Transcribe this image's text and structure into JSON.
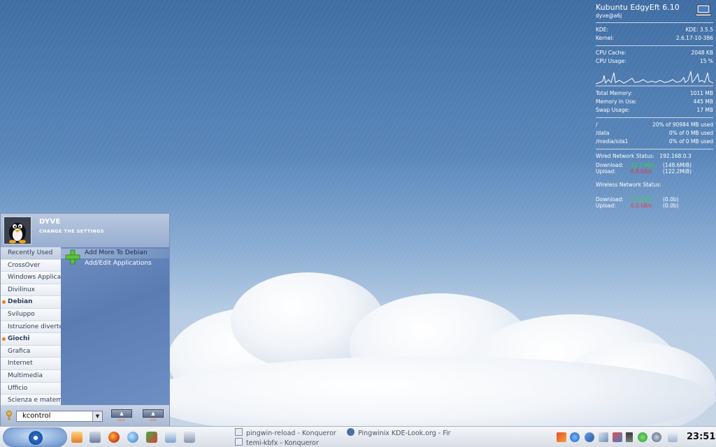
{
  "sysmon": {
    "title": "Kubuntu EdgyEft 6.10",
    "user_host": "dyve@a6j",
    "rows1": [
      {
        "label": "KDE:",
        "value": "KDE: 3.5.5"
      },
      {
        "label": "Kernel:",
        "value": "2.6.17-10-386"
      }
    ],
    "rows2": [
      {
        "label": "CPU Cache:",
        "value": "2048 KB"
      },
      {
        "label": "CPU Usage:",
        "value": "15 %"
      }
    ],
    "rows3": [
      {
        "label": "Total Memory:",
        "value": "1011 MB"
      },
      {
        "label": "Memory In Use:",
        "value": "445 MB"
      },
      {
        "label": "Swap Usage:",
        "value": "17 MB"
      }
    ],
    "disks": [
      {
        "label": "/",
        "value": "20% of 90984 MB used"
      },
      {
        "label": "/data",
        "value": "0% of 0 MB used"
      },
      {
        "label": "/media/sda1",
        "value": "0% of 0 MB used"
      }
    ],
    "wired_label": "Wired Network Status:",
    "wired_ip": "192.168.0.3",
    "download_label": "Download:",
    "upload_label": "Upload:",
    "wired_down_rate": "16.2 kB/s",
    "wired_down_total": "(148.6MiB)",
    "wired_up_rate": "6.8 kB/s",
    "wired_up_total": "(122.2MiB)",
    "wireless_label": "Wireless Network Status:",
    "wl_down_rate": "0.0 kB/s",
    "wl_down_total": "(0.0b)",
    "wl_up_rate": "0.0 kB/s",
    "wl_up_total": "(0.0b)",
    "colors": {
      "download": "#3ad43a",
      "upload": "#e23a3a"
    }
  },
  "menu": {
    "user_name": "DYVE",
    "user_sub": "CHANGE THE SETTINGS",
    "categories": [
      {
        "label": "Recently Used"
      },
      {
        "label": "CrossOver"
      },
      {
        "label": "Windows Applicat"
      },
      {
        "label": "Divilinux"
      },
      {
        "label": "Debian"
      },
      {
        "label": "Sviluppo"
      },
      {
        "label": "Istruzione diverte"
      },
      {
        "label": "Giochi"
      },
      {
        "label": "Grafica"
      },
      {
        "label": "Internet"
      },
      {
        "label": "Multimedia"
      },
      {
        "label": "Ufficio"
      },
      {
        "label": "Scienza e matem"
      }
    ],
    "apps": [
      {
        "label": "Add More To Debian"
      },
      {
        "label": "Add/Edit Applications"
      }
    ],
    "search_value": "kcontrol",
    "footer_buttons": [
      {
        "label": "lock"
      },
      {
        "label": "exit"
      }
    ]
  },
  "taskbar": {
    "tasks": [
      {
        "label": "pingwin-reload - Konqueror"
      },
      {
        "label": "Pingwinix KDE-Look.org - Fir"
      },
      {
        "label": "temi-kbfx - Konqueror"
      }
    ],
    "clock": "23:51"
  }
}
